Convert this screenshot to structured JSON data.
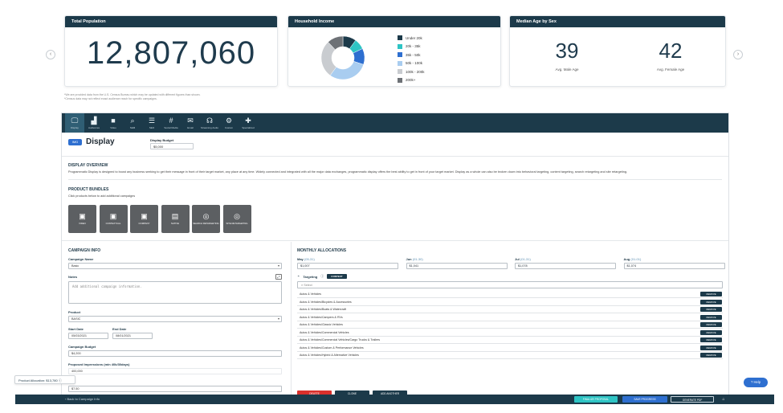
{
  "stats": {
    "population": {
      "title": "Total Population",
      "value": "12,807,060"
    },
    "income": {
      "title": "Household Income",
      "legend": [
        {
          "label": "Under 20k",
          "color": "#1c3a4a"
        },
        {
          "label": "20k - 35k",
          "color": "#2ec4c4"
        },
        {
          "label": "35k - 50k",
          "color": "#2e6fd0"
        },
        {
          "label": "50k - 100k",
          "color": "#a9cdf0"
        },
        {
          "label": "100k - 200k",
          "color": "#c9ccd0"
        },
        {
          "label": "200k+",
          "color": "#6d7176"
        }
      ],
      "shares": [
        10,
        8,
        12,
        30,
        28,
        12
      ]
    },
    "age": {
      "title": "Median Age by Sex",
      "male_value": "39",
      "male_label": "Avg. Male Age",
      "female_value": "42",
      "female_label": "Avg. Female Age"
    },
    "footnote_1": "*We are provided data from the U.S. Census Bureau which may be updated with different figures than shown.",
    "footnote_2": "*Census data may not reflect exact audience reach for specific campaigns."
  },
  "nav": [
    {
      "label": "Display",
      "icon": "🖵",
      "name": "display"
    },
    {
      "label": "Audiences",
      "icon": "▟",
      "name": "audiences"
    },
    {
      "label": "Video",
      "icon": "■",
      "name": "video"
    },
    {
      "label": "SEM",
      "icon": "⌕",
      "name": "sem"
    },
    {
      "label": "SEO",
      "icon": "☰",
      "name": "seo"
    },
    {
      "label": "Social Media",
      "icon": "#",
      "name": "social-media"
    },
    {
      "label": "Email",
      "icon": "✉",
      "name": "email"
    },
    {
      "label": "Streaming Audio",
      "icon": "☊",
      "name": "streaming-audio"
    },
    {
      "label": "Custom",
      "icon": "⚙",
      "name": "custom"
    },
    {
      "label": "Specialized",
      "icon": "✚",
      "name": "specialized"
    }
  ],
  "display": {
    "badge": "IMG",
    "title": "Display",
    "budget_label": "Display Budget",
    "budget_value": "$5,000"
  },
  "overview": {
    "title": "DISPLAY OVERVIEW",
    "text": "Programmatic Display is designed to boost any business seeking to get their message in front of their target market, any place at any time. Widely connected and integrated with all the major data exchanges, programmatic display offers the best ability to get in front of your target market. Display as a whole can also be broken down into behavioral targeting, content targeting, search retargeting and site retargeting."
  },
  "bundles": {
    "title": "PRODUCT BUNDLES",
    "subtitle": "Click products below to add additional campaigns",
    "items": [
      {
        "label": "VIDEO",
        "icon": "▣"
      },
      {
        "label": "CONTEXTUAL",
        "icon": "▣"
      },
      {
        "label": "COMPANY",
        "icon": "▣"
      },
      {
        "label": "NATIVE",
        "icon": "▤"
      },
      {
        "label": "SEARCH RETARGETING",
        "icon": "◎"
      },
      {
        "label": "SITE RETARGETING",
        "icon": "◎"
      }
    ]
  },
  "campaign": {
    "title": "CAMPAIGN INFO",
    "name_label": "Campaign Name",
    "name_value": "Basic",
    "notes_label": "Notes",
    "notes_placeholder": "Add additional campaign information.",
    "product_label": "Product",
    "product_value": "BASIC",
    "start_label": "Start Date",
    "start_value": "05/03/2021",
    "end_label": "End Date",
    "end_value": "08/01/2021",
    "budget_label": "Campaign Budget",
    "budget_value": "$4,200",
    "impressions_label": "Proposed Impressions (min 40k/30days)",
    "impressions_value": "400,000",
    "cpm_value": "$7.50"
  },
  "monthly": {
    "title": "MONTHLY ALLOCATIONS",
    "months": [
      {
        "label": "May",
        "range": "(05-31)",
        "value": "$1,007"
      },
      {
        "label": "Jun",
        "range": "(01-30)",
        "value": "$1,041"
      },
      {
        "label": "Jul",
        "range": "(01-31)",
        "value": "$1,078"
      },
      {
        "label": "Aug",
        "range": "(01-01)",
        "value": "$1,074"
      }
    ],
    "targeting_label": "Targeting",
    "targeting_badge": "CONTEXT",
    "search_placeholder": "Select",
    "remove_label": "REMOVE",
    "segments": [
      "Autos & Vehicles",
      "Autos & Vehicles/Bicycles & Accessories",
      "Autos & Vehicles/Boats & Watercraft",
      "Autos & Vehicles/Campers & RVs",
      "Autos & Vehicles/Classic Vehicles",
      "Autos & Vehicles/Commercial Vehicles",
      "Autos & Vehicles/Commercial Vehicles/Cargo Trucks & Trailers",
      "Autos & Vehicles/Custom & Performance Vehicles",
      "Autos & Vehicles/Hybrid & Alternative Vehicles"
    ]
  },
  "actions": {
    "delete": "DELETE",
    "clone": "CLONE",
    "add_another": "ADD ANOTHER"
  },
  "bottom": {
    "back": "Back to Campaign Info",
    "finalize": "FINALIZE PROPOSAL",
    "save": "SAVE PROGRESS",
    "generate": "GENERATE PDF",
    "allocation": "Product Allocation: $13,780",
    "help": "Help"
  },
  "colors": {
    "navy": "#1c3a4a",
    "accent_blue": "#2e6fd0",
    "delete_red": "#d9302c",
    "teal": "#2ec4c4"
  }
}
